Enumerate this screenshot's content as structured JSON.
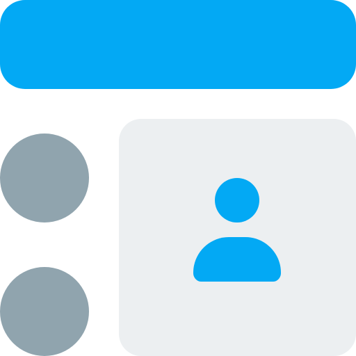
{
  "colors": {
    "accent": "#03A9F4",
    "bullet": "#90A4AE",
    "panel": "#ECEFF1",
    "icon": "#03A9F4"
  },
  "icons": {
    "header": "header-bar",
    "bullets": [
      "list-bullet",
      "list-bullet"
    ],
    "panel_icon": "user-icon"
  }
}
